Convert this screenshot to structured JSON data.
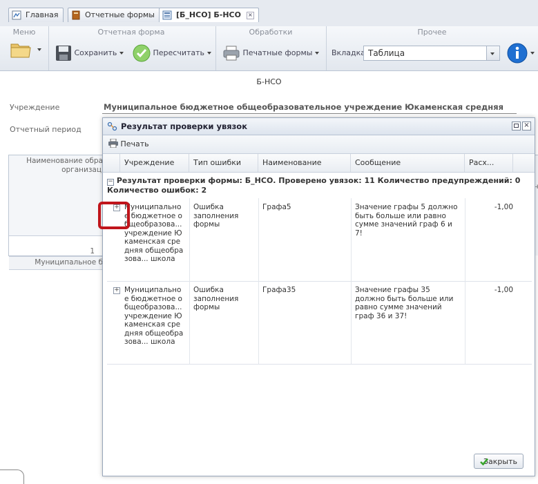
{
  "tabs": [
    {
      "label": "Главная",
      "icon": "home-icon"
    },
    {
      "label": "Отчетные формы",
      "icon": "book-icon"
    },
    {
      "label": "[Б_НСО] Б-НСО",
      "icon": "form-icon"
    }
  ],
  "toolbar": {
    "groups": {
      "menu": "Меню",
      "report_form": "Отчетная форма",
      "processing": "Обработки",
      "other": "Прочее"
    },
    "save_label": "Сохранить",
    "recalc_label": "Пересчитать",
    "print_forms_label": "Печатные формы",
    "tab_label": "Вкладка",
    "tab_value": "Таблица"
  },
  "form": {
    "title": "Б-НСО",
    "institution_label": "Учреждение",
    "institution_value": "Муниципальное бюджетное общеобразовательное учреждение Юкаменская средняя",
    "period_label": "Отчетный период"
  },
  "background_grid": {
    "header_line1": "Наименование обра",
    "header_line2": "организац",
    "num": "1",
    "row_value": "Муниципальное б",
    "right_fragment": "н"
  },
  "dialog": {
    "title": "Результат проверки увязок",
    "print_label": "Печать",
    "columns": [
      "Учреждение",
      "Тип ошибки",
      "Наименование",
      "Сообщение",
      "Расх..."
    ],
    "group_text": "Результат проверки формы: Б_НСО. Проверено увязок: 11 Количество предупреждений: 0 Количество ошибок: 2",
    "rows": [
      {
        "institution": "Муниципальное бюджетное общеобразова... учреждение Юкаменская средняя общеобразова... школа",
        "error_type": "Ошибка заполнения формы",
        "name": "Графа5",
        "message": "Значение графы 5 должно быть больше или равно сумме значений граф 6 и 7!",
        "diff": "-1,00"
      },
      {
        "institution": "Муниципальное бюджетное общеобразова... учреждение Юкаменская средняя общеобразова... школа",
        "error_type": "Ошибка заполнения формы",
        "name": "Графа35",
        "message": "Значение графы 35 должно быть больше или равно сумме значений граф 36 и 37!",
        "diff": "-1,00"
      }
    ],
    "close_label": "Закрыть"
  },
  "colors": {
    "highlight": "#c0151b",
    "accent_blue": "#1f6fd1",
    "check_green": "#3aa52e"
  }
}
